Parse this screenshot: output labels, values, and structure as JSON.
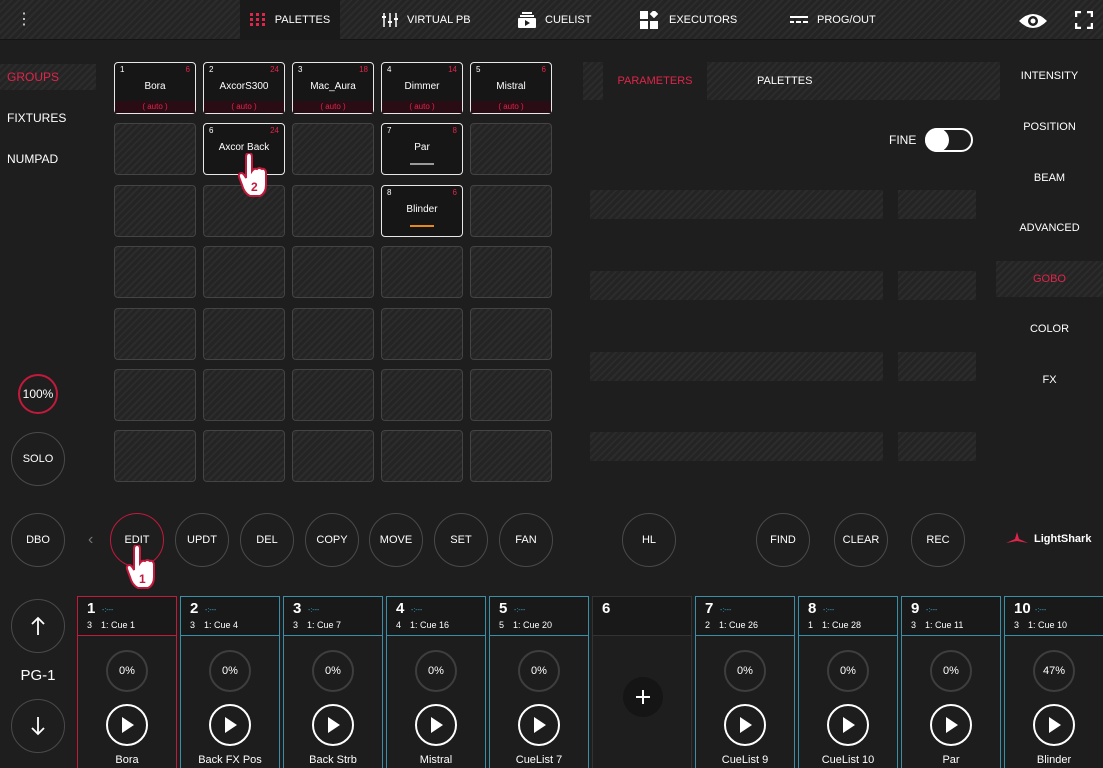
{
  "topbar": {
    "tabs": [
      {
        "id": "palettes",
        "label": "PALETTES",
        "icon": "grid-dots-icon"
      },
      {
        "id": "virtual_pb",
        "label": "VIRTUAL PB",
        "icon": "sliders-icon"
      },
      {
        "id": "cuelist",
        "label": "CUELIST",
        "icon": "cuelist-icon"
      },
      {
        "id": "executors",
        "label": "EXECUTORS",
        "icon": "executors-icon"
      },
      {
        "id": "prog_out",
        "label": "PROG/OUT",
        "icon": "prog-out-icon"
      }
    ],
    "accent": "#e0254a"
  },
  "left_nav": [
    {
      "label": "GROUPS",
      "active": true
    },
    {
      "label": "FIXTURES",
      "active": false
    },
    {
      "label": "NUMPAD",
      "active": false
    }
  ],
  "grid": {
    "tiles": [
      {
        "num": "1",
        "count": "6",
        "name": "Bora",
        "sub": "( auto )"
      },
      {
        "num": "2",
        "count": "24",
        "name": "AxcorS300",
        "sub": "( auto )"
      },
      {
        "num": "3",
        "count": "18",
        "name": "Mac_Aura",
        "sub": "( auto )"
      },
      {
        "num": "4",
        "count": "14",
        "name": "Dimmer",
        "sub": "( auto )"
      },
      {
        "num": "5",
        "count": "6",
        "name": "Mistral",
        "sub": "( auto )"
      },
      {
        "num": "6",
        "count": "24",
        "name": "Axcor Back",
        "sub": ""
      },
      {
        "num": "7",
        "count": "8",
        "name": "Par",
        "sub": "",
        "bar_color": "#9a9a9a"
      },
      {
        "num": "8",
        "count": "6",
        "name": "Blinder",
        "sub": "",
        "bar_color": "#e88a1a"
      }
    ]
  },
  "left_controls": {
    "master": "100%",
    "solo": "SOLO",
    "dbo": "DBO"
  },
  "command_bar": {
    "buttons": [
      "EDIT",
      "UPDT",
      "DEL",
      "COPY",
      "MOVE",
      "SET",
      "FAN"
    ],
    "hl": "HL",
    "right_buttons": [
      "FIND",
      "CLEAR",
      "REC"
    ],
    "prev_arrow": "‹"
  },
  "brand": {
    "name": "LightShark"
  },
  "step_markers": {
    "edit": "1",
    "tile": "2"
  },
  "params": {
    "tabs": [
      {
        "label": "PARAMETERS",
        "active": true
      },
      {
        "label": "PALETTES",
        "active": false
      }
    ],
    "fine_label": "FINE",
    "fine_on": true
  },
  "right_nav": [
    {
      "label": "INTENSITY",
      "active": false
    },
    {
      "label": "POSITION",
      "active": false
    },
    {
      "label": "BEAM",
      "active": false
    },
    {
      "label": "ADVANCED",
      "active": false
    },
    {
      "label": "GOBO",
      "active": true
    },
    {
      "label": "COLOR",
      "active": false
    },
    {
      "label": "FX",
      "active": false
    }
  ],
  "page": {
    "label": "PG-1"
  },
  "executors": [
    {
      "num": "1",
      "dash": "-:---",
      "cues": "3",
      "cue": "1: Cue 1",
      "level": "0%",
      "level_value": 0,
      "name": "Bora",
      "border": "red"
    },
    {
      "num": "2",
      "dash": "-:---",
      "cues": "3",
      "cue": "1: Cue 4",
      "level": "0%",
      "level_value": 0,
      "name": "Back FX Pos",
      "border": "blue"
    },
    {
      "num": "3",
      "dash": "-:---",
      "cues": "3",
      "cue": "1: Cue 7",
      "level": "0%",
      "level_value": 0,
      "name": "Back Strb",
      "border": "blue"
    },
    {
      "num": "4",
      "dash": "-:---",
      "cues": "4",
      "cue": "1: Cue 16",
      "level": "0%",
      "level_value": 0,
      "name": "Mistral",
      "border": "blue"
    },
    {
      "num": "5",
      "dash": "-:---",
      "cues": "5",
      "cue": "1: Cue 20",
      "level": "0%",
      "level_value": 0,
      "name": "CueList 7",
      "border": "blue"
    },
    {
      "num": "6",
      "empty": true
    },
    {
      "num": "7",
      "dash": "-:---",
      "cues": "2",
      "cue": "1: Cue 26",
      "level": "0%",
      "level_value": 0,
      "name": "CueList 9",
      "border": "blue"
    },
    {
      "num": "8",
      "dash": "-:---",
      "cues": "1",
      "cue": "1: Cue 28",
      "level": "0%",
      "level_value": 0,
      "name": "CueList 10",
      "border": "blue"
    },
    {
      "num": "9",
      "dash": "-:---",
      "cues": "3",
      "cue": "1: Cue 11",
      "level": "0%",
      "level_value": 0,
      "name": "Par",
      "border": "blue"
    },
    {
      "num": "10",
      "dash": "-:---",
      "cues": "3",
      "cue": "1: Cue 10",
      "level": "47%",
      "level_value": 47,
      "name": "Blinder",
      "border": "blue"
    }
  ]
}
